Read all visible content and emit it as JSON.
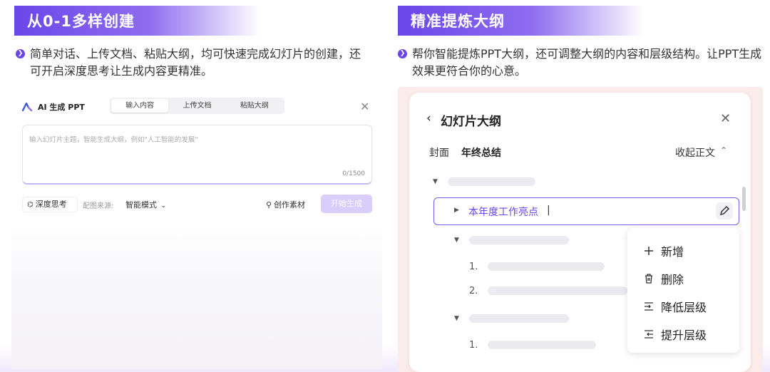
{
  "left_section": {
    "title": "从0-1多样创建",
    "description": "简单对话、上传文档、粘贴大纲，均可快速完成幻灯片的创建，还可开启深度思考让生成内容更精准。",
    "dialog": {
      "logo_label": "AI 生成 PPT",
      "tabs": [
        "输入内容",
        "上传文档",
        "粘贴大纲"
      ],
      "active_tab": "输入内容",
      "close_icon": "close-icon",
      "input_placeholder": "输入幻灯片主题，智能生成大纲，例如\"人工智能的发展\"",
      "char_count": "0/1500",
      "deep_think_label": "深度思考",
      "image_source_label": "配图来源:",
      "image_source_value": "智能模式",
      "material_label": "创作素材",
      "start_button": "开始生成"
    }
  },
  "right_section": {
    "title": "精准提炼大纲",
    "description": "帮你智能提炼PPT大纲，还可调整大纲的内容和层级结构。让PPT生成效果更符合你的心意。",
    "outline": {
      "title": "幻灯片大纲",
      "cover_label": "封面",
      "cover_value": "年终总结",
      "collapse_label": "收起正文",
      "selected_item": "本年度工作亮点",
      "numbers": [
        "1.",
        "2.",
        "1."
      ],
      "menu": [
        "新增",
        "删除",
        "降低层级",
        "提升层级"
      ]
    }
  },
  "colors": {
    "accent": "#6a46e8",
    "accent_light": "#d9cdfb",
    "panel_bg": "#fbeceb"
  }
}
